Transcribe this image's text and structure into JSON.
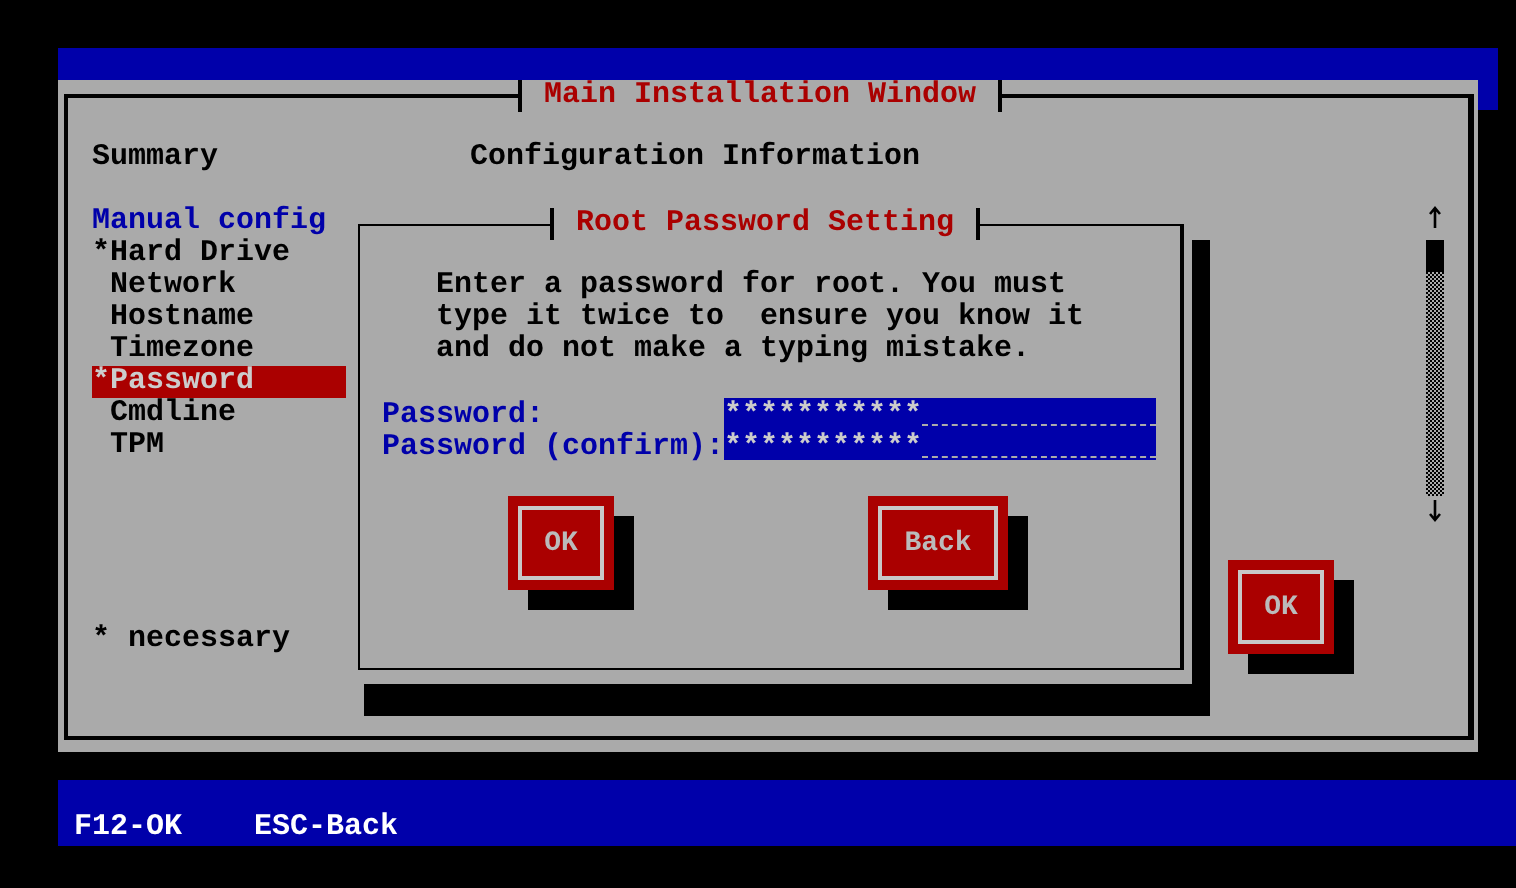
{
  "window": {
    "title": "Main Installation Window"
  },
  "summary_heading": "Summary",
  "config_heading": "Configuration Information",
  "sidebar": {
    "items": [
      {
        "label": "Manual config",
        "kind": "heading",
        "selected": false
      },
      {
        "label": "*Hard Drive",
        "kind": "required",
        "selected": false
      },
      {
        "label": "Network",
        "kind": "optional",
        "selected": false
      },
      {
        "label": "Hostname",
        "kind": "optional",
        "selected": false
      },
      {
        "label": "Timezone",
        "kind": "optional",
        "selected": false
      },
      {
        "label": "*Password",
        "kind": "required",
        "selected": true
      },
      {
        "label": "Cmdline",
        "kind": "optional",
        "selected": false
      },
      {
        "label": "TPM",
        "kind": "optional",
        "selected": false
      }
    ]
  },
  "legend": "* necessary",
  "main_button": "OK",
  "dialog": {
    "title": "Root Password Setting",
    "message": [
      "Enter a password for root. You must",
      "type it twice to  ensure you know it",
      "and do not make a typing mistake."
    ],
    "fields": [
      {
        "label": "Password:",
        "value": "***********"
      },
      {
        "label": "Password (confirm):",
        "value": "***********"
      }
    ],
    "buttons": [
      "OK",
      "Back"
    ]
  },
  "status_bar": [
    "F12-OK",
    "ESC-Back"
  ]
}
